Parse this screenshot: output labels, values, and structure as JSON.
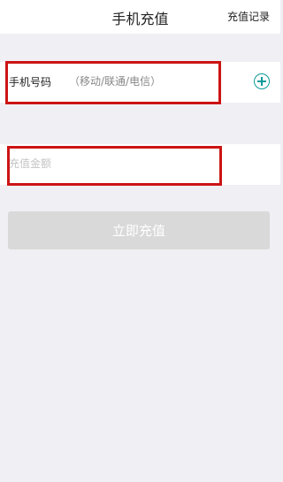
{
  "header": {
    "title": "手机充值",
    "action_label": "充值记录"
  },
  "phone_field": {
    "label": "手机号码",
    "placeholder": "（移动/联通/电信）"
  },
  "amount_field": {
    "placeholder": "充值金额"
  },
  "submit": {
    "label": "立即充值"
  },
  "icons": {
    "add_contact": "add-circle-icon"
  },
  "colors": {
    "accent": "#0d9a9a",
    "highlight": "#cc1414",
    "button_disabled": "#d9d9d9"
  }
}
